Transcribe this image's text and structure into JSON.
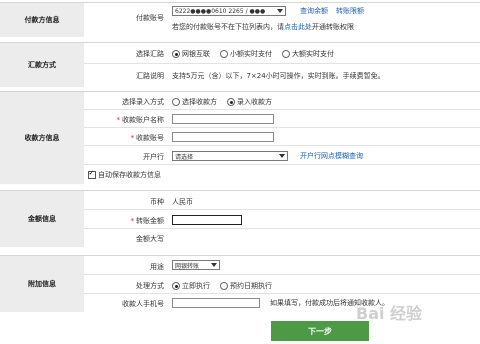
{
  "payer": {
    "category": "付款方信息",
    "account_label": "付款账号",
    "account_value": "6222●●●●0610 2265 / ●●●",
    "link_query": "查询余额",
    "link_limit": "转账限额",
    "hint_prefix": "若您的付款账号不在下拉列表内，请",
    "hint_link": "点击此处",
    "hint_suffix": "开通转账权限"
  },
  "remit": {
    "category": "汇款方式",
    "route_label": "选择汇路",
    "options": [
      "网银互联",
      "小额实时支付",
      "大额实时支付"
    ],
    "selected": 0,
    "desc_label": "汇路说明",
    "desc_text": "支持5万元（含）以下，7×24小时可操作，实时到账。手续费暂免。"
  },
  "payee": {
    "category": "收款方信息",
    "mode_label": "选择录入方式",
    "mode_options": [
      "选择收款方",
      "录入收款方"
    ],
    "mode_selected": 1,
    "name_label": "收款账户名称",
    "acct_label": "收款账号",
    "bank_label": "开户行",
    "bank_select": "请选择",
    "bank_link": "开户行网点模糊查询",
    "autosave_label": "自动保存收款方信息"
  },
  "amount": {
    "category": "金额信息",
    "currency_label": "币种",
    "currency_value": "人民币",
    "amt_label": "转账金额",
    "upper_label": "金额大写"
  },
  "extra": {
    "category": "附加信息",
    "usage_label": "用途",
    "usage_select": "网银转账",
    "process_label": "处理方式",
    "process_options": [
      "立即执行",
      "预约日期执行"
    ],
    "process_selected": 0,
    "phone_label": "收款人手机号",
    "phone_hint": "如果填写，付款成功后将通知收款人。"
  },
  "next_button": "下一步",
  "watermark": "Bai 经验"
}
